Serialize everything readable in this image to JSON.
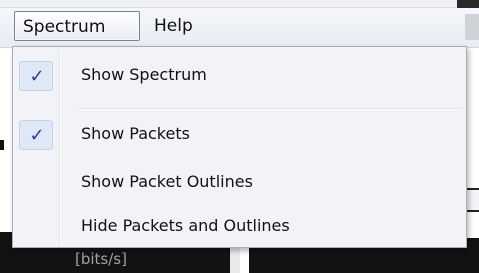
{
  "menubar": {
    "items": [
      {
        "label": "Spectrum",
        "active": true
      },
      {
        "label": "Help",
        "active": false
      }
    ]
  },
  "dropdown": {
    "items": [
      {
        "label": "Show Spectrum",
        "checked": true,
        "check_glyph": "✓"
      },
      {
        "separator": true
      },
      {
        "label": "Show Packets",
        "checked": true,
        "check_glyph": "✓"
      },
      {
        "label": "Show Packet Outlines",
        "checked": false
      },
      {
        "label": "Hide Packets and Outlines",
        "checked": false
      }
    ]
  },
  "background": {
    "unit_label": "[bits/s]"
  },
  "colors": {
    "check_color": "#1f3f9a",
    "check_bg": "#dfe8f6",
    "menu_bg": "#f1f3f6",
    "dark_panel": "#121212"
  },
  "icons": {
    "check": "checkmark-icon"
  }
}
